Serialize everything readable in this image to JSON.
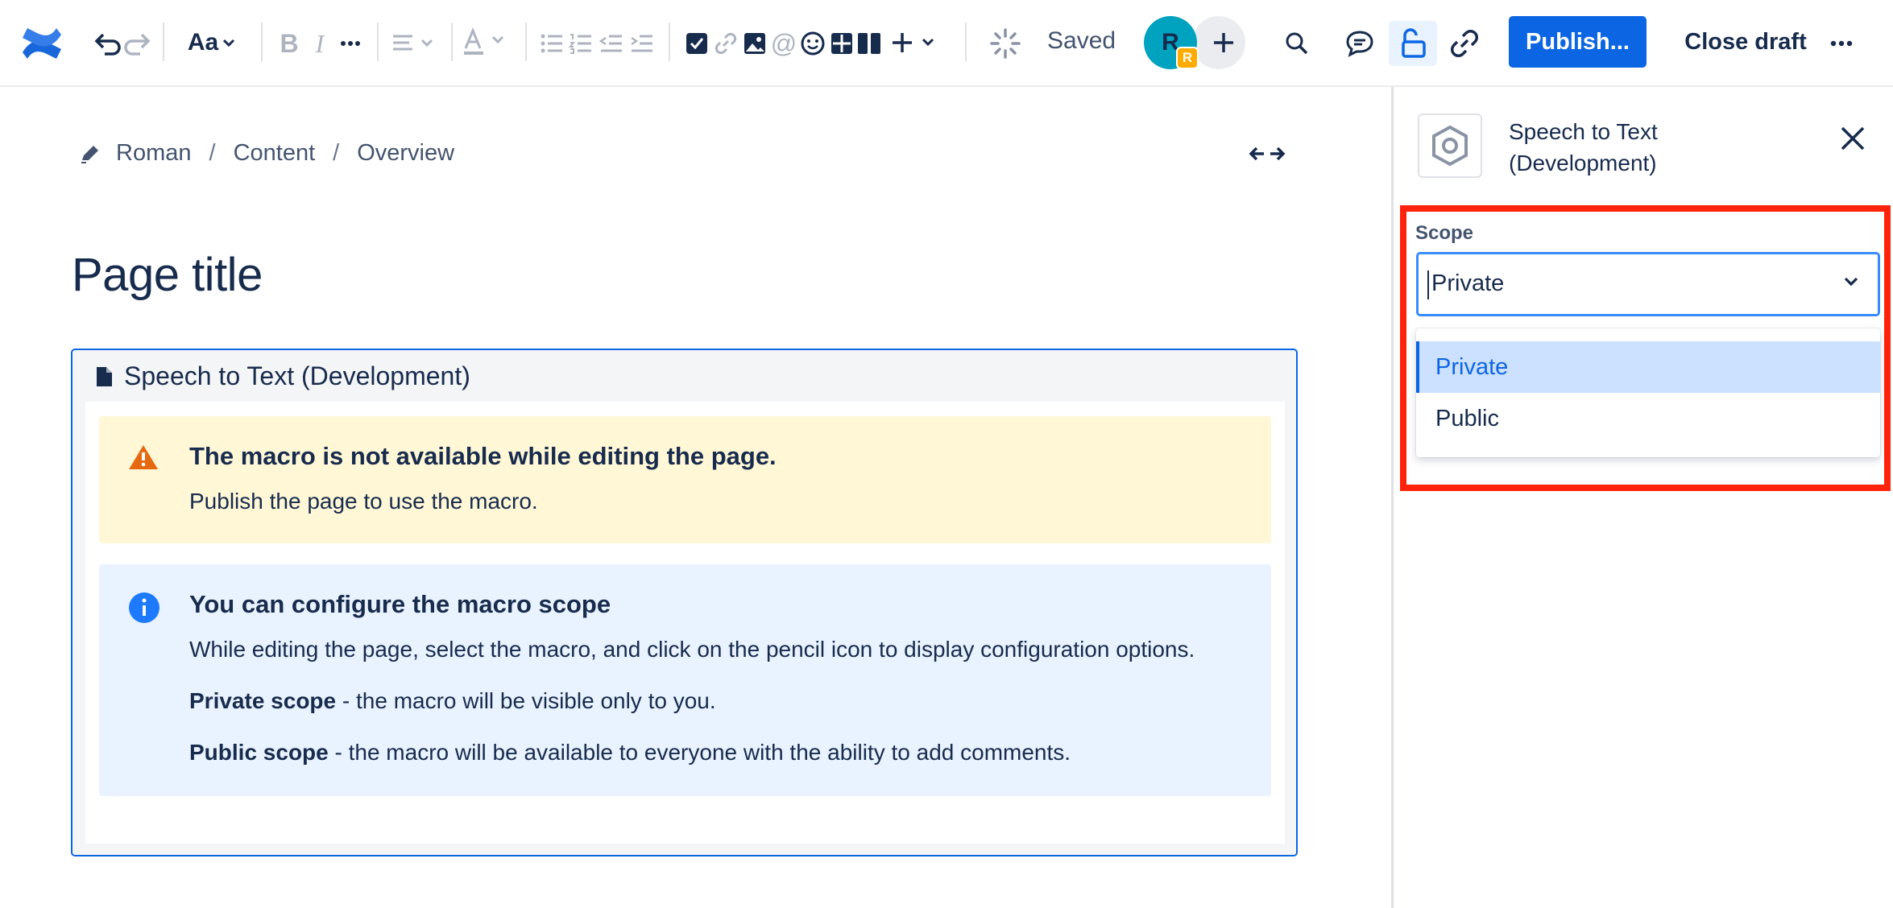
{
  "toolbar": {
    "saved_label": "Saved",
    "avatar_initial": "R",
    "avatar_badge": "R",
    "text_style_label": "Aa",
    "publish_label": "Publish...",
    "close_draft_label": "Close draft",
    "icons": [
      "confluence-logo",
      "undo",
      "redo",
      "text-style",
      "bold",
      "italic",
      "more-formatting",
      "align",
      "text-color",
      "bullet-list",
      "numbered-list",
      "outdent",
      "indent",
      "action-item",
      "link",
      "image",
      "mention",
      "emoji",
      "table",
      "layouts",
      "insert",
      "saving-spinner",
      "invite",
      "search",
      "comments",
      "restrictions-unlocked",
      "copy-link",
      "more"
    ]
  },
  "breadcrumb": {
    "items": [
      "Roman",
      "Content",
      "Overview"
    ]
  },
  "page": {
    "title": "Page title"
  },
  "macro": {
    "title": "Speech to Text (Development)",
    "warning": {
      "title": "The macro is not available while editing the page.",
      "text": "Publish the page to use the macro."
    },
    "info": {
      "title": "You can configure the macro scope",
      "text": "While editing the page, select the macro, and click on the pencil icon to display configuration options.",
      "private_bold": "Private scope",
      "private_text": " - the macro will be visible only to you.",
      "public_bold": "Public scope",
      "public_text": " - the macro will be available to everyone with the ability to add comments."
    }
  },
  "side_panel": {
    "title": "Speech to Text (Development)",
    "scope_label": "Scope",
    "selected_value": "Private",
    "options": [
      "Private",
      "Public"
    ]
  },
  "colors": {
    "primary": "#0c66e4",
    "warning_bg": "#fff7d6",
    "info_bg": "#e9f2ff",
    "highlight": "#ff230b",
    "selected_option_bg": "#cce0ff"
  }
}
